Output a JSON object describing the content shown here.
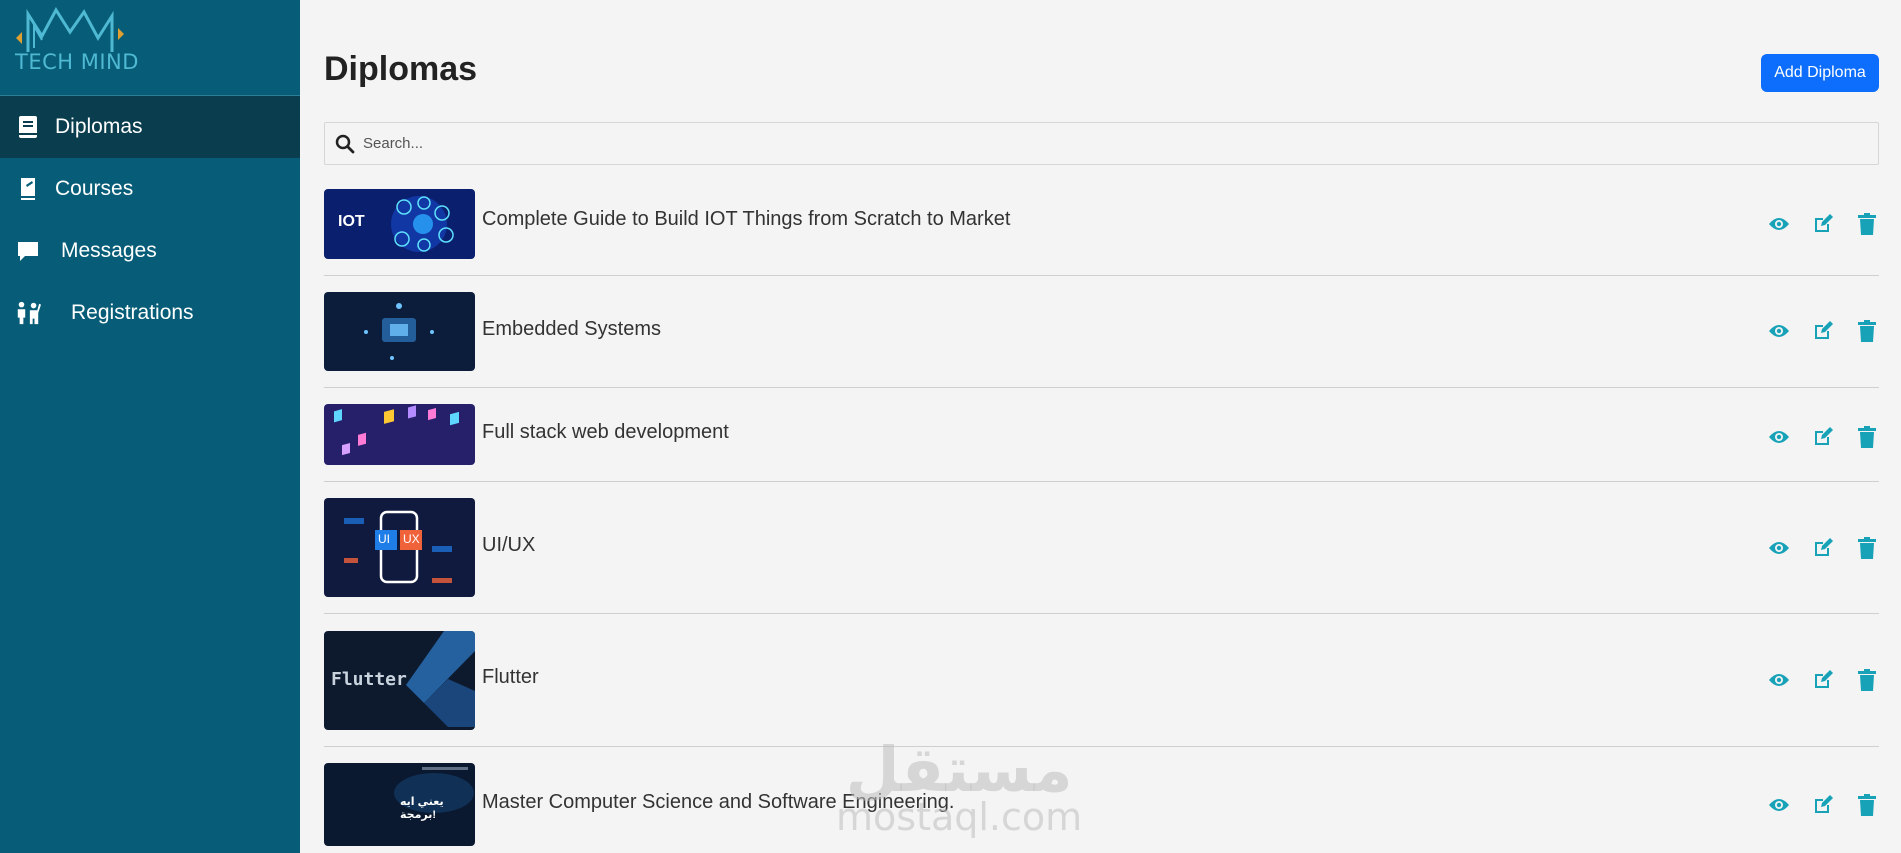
{
  "sidebar": {
    "logo_text": "TECH MIND",
    "items": [
      {
        "label": "Diplomas",
        "icon": "book-icon",
        "active": true
      },
      {
        "label": "Courses",
        "icon": "notebook-icon",
        "active": false
      },
      {
        "label": "Messages",
        "icon": "message-icon",
        "active": false
      },
      {
        "label": "Registrations",
        "icon": "people-icon",
        "active": false
      }
    ]
  },
  "header": {
    "title": "Diplomas",
    "add_button_label": "Add Diploma"
  },
  "search": {
    "placeholder": "Search...",
    "value": ""
  },
  "diplomas": [
    {
      "title": "Complete Guide to Build IOT Things from Scratch to Market",
      "thumb_text": "IOT"
    },
    {
      "title": "Embedded Systems"
    },
    {
      "title": "Full stack web development"
    },
    {
      "title": "UI/UX",
      "thumb_text_a": "UI",
      "thumb_text_b": "UX"
    },
    {
      "title": "Flutter",
      "thumb_text": "Flutter"
    },
    {
      "title": "Master Computer Science and Software Engineering.",
      "thumb_text": "يعني ايه برمجة!"
    }
  ],
  "row_actions": [
    "eye-icon",
    "edit-icon",
    "trash-icon"
  ],
  "watermark": {
    "arabic": "مستقل",
    "latin": "mostaql.com"
  },
  "colors": {
    "sidebar_bg": "#075d77",
    "sidebar_active_bg": "#0a3d4d",
    "primary_button": "#0d6efd",
    "action_icon": "#17a2b8",
    "page_bg": "#f4f4f4"
  }
}
